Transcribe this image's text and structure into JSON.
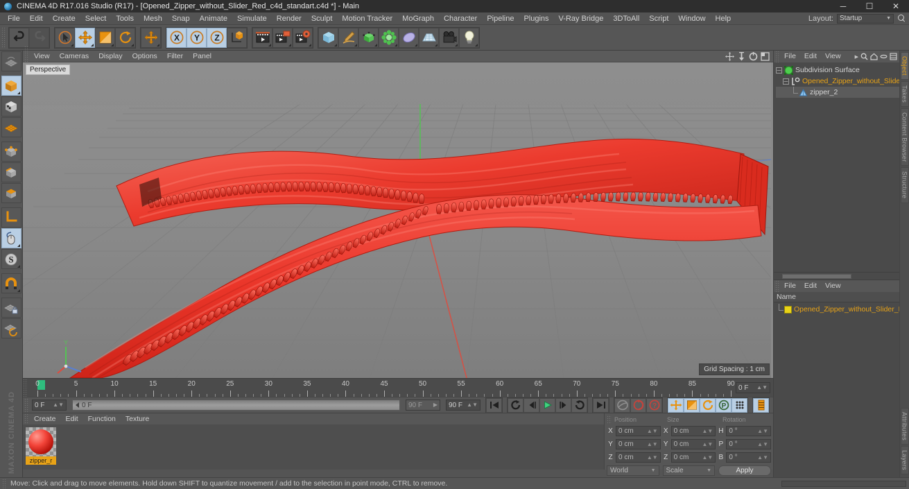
{
  "window": {
    "title": "CINEMA 4D R17.016 Studio (R17) - [Opened_Zipper_without_Slider_Red_c4d_standart.c4d *] - Main",
    "minimize": "─",
    "maximize": "☐",
    "close": "✕"
  },
  "menubar": {
    "items": [
      "File",
      "Edit",
      "Create",
      "Select",
      "Tools",
      "Mesh",
      "Snap",
      "Animate",
      "Simulate",
      "Render",
      "Sculpt",
      "Motion Tracker",
      "MoGraph",
      "Character",
      "Pipeline",
      "Plugins",
      "V-Ray Bridge",
      "3DToAll",
      "Script",
      "Window",
      "Help"
    ],
    "layout_label": "Layout:",
    "layout_value": "Startup"
  },
  "viewport": {
    "menu": [
      "View",
      "Cameras",
      "Display",
      "Options",
      "Filter",
      "Panel"
    ],
    "label": "Perspective",
    "grid_spacing": "Grid Spacing : 1 cm",
    "model_color": "#ee3b30",
    "bg_color": "#8a8a8a"
  },
  "timeline": {
    "labels": [
      "0",
      "5",
      "10",
      "15",
      "20",
      "25",
      "30",
      "35",
      "40",
      "45",
      "50",
      "55",
      "60",
      "65",
      "70",
      "75",
      "80",
      "85",
      "90"
    ],
    "current_frame": "0 F",
    "start_frame": "0 F",
    "end_frame": "90 F",
    "preview_end": "90 F",
    "scrub_value": "0 F"
  },
  "materials": {
    "menu": [
      "Create",
      "Edit",
      "Function",
      "Texture"
    ],
    "items": [
      {
        "name": "zipper_r",
        "color": "#f3453a"
      }
    ]
  },
  "coordinates": {
    "headers": [
      "Position",
      "Size",
      "Rotation"
    ],
    "rows": [
      {
        "axis": "X",
        "position": "0 cm",
        "axis2": "X",
        "size": "0 cm",
        "axis3": "H",
        "rotation": "0 °"
      },
      {
        "axis": "Y",
        "position": "0 cm",
        "axis2": "Y",
        "size": "0 cm",
        "axis3": "P",
        "rotation": "0 °"
      },
      {
        "axis": "Z",
        "position": "0 cm",
        "axis2": "Z",
        "size": "0 cm",
        "axis3": "B",
        "rotation": "0 °"
      }
    ],
    "system": "World",
    "mode": "Scale",
    "apply": "Apply"
  },
  "object_manager": {
    "menu": [
      "File",
      "Edit",
      "View"
    ],
    "tree": [
      {
        "label": "Subdivision Surface",
        "icon": "subdivision-surface-icon"
      },
      {
        "label": "Opened_Zipper_without_Slider_",
        "icon": "null-object-icon"
      },
      {
        "label": "zipper_2",
        "icon": "polygon-object-icon"
      }
    ]
  },
  "attribute_manager": {
    "menu": [
      "File",
      "Edit",
      "View"
    ],
    "column_header": "Name",
    "rows": [
      {
        "label": "Opened_Zipper_without_Slider_R",
        "color": "#e8a317"
      }
    ]
  },
  "side_tabs": {
    "top": [
      "Object",
      "Takes",
      "Content Browser",
      "Structure"
    ],
    "bottom": [
      "Attributes",
      "Layers"
    ]
  },
  "statusbar": {
    "text": "Move: Click and drag to move elements. Hold down SHIFT to quantize movement / add to the selection in point mode, CTRL to remove."
  },
  "branding": {
    "text": "MAXON CINEMA 4D"
  }
}
